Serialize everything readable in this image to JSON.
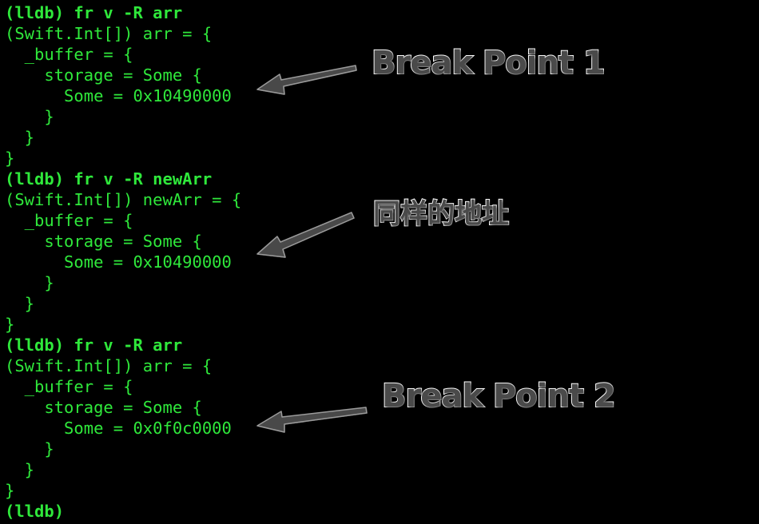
{
  "terminal": {
    "text_color": "#2fe83b",
    "background_color": "#000000",
    "lines": [
      {
        "text": "(lldb) fr v -R arr",
        "kind": "cmd"
      },
      {
        "text": "(Swift.Int[]) arr = {",
        "kind": "out"
      },
      {
        "text": "  _buffer = {",
        "kind": "out"
      },
      {
        "text": "    storage = Some {",
        "kind": "out"
      },
      {
        "text": "      Some = 0x10490000",
        "kind": "out"
      },
      {
        "text": "    }",
        "kind": "out"
      },
      {
        "text": "  }",
        "kind": "out"
      },
      {
        "text": "}",
        "kind": "out"
      },
      {
        "text": "(lldb) fr v -R newArr",
        "kind": "cmd"
      },
      {
        "text": "(Swift.Int[]) newArr = {",
        "kind": "out"
      },
      {
        "text": "  _buffer = {",
        "kind": "out"
      },
      {
        "text": "    storage = Some {",
        "kind": "out"
      },
      {
        "text": "      Some = 0x10490000",
        "kind": "out"
      },
      {
        "text": "    }",
        "kind": "out"
      },
      {
        "text": "  }",
        "kind": "out"
      },
      {
        "text": "}",
        "kind": "out"
      },
      {
        "text": "(lldb) fr v -R arr",
        "kind": "cmd"
      },
      {
        "text": "(Swift.Int[]) arr = {",
        "kind": "out"
      },
      {
        "text": "  _buffer = {",
        "kind": "out"
      },
      {
        "text": "    storage = Some {",
        "kind": "out"
      },
      {
        "text": "      Some = 0x0f0c0000",
        "kind": "out"
      },
      {
        "text": "    }",
        "kind": "out"
      },
      {
        "text": "  }",
        "kind": "out"
      },
      {
        "text": "}",
        "kind": "out"
      },
      {
        "text": "(lldb)",
        "kind": "cmd"
      }
    ]
  },
  "annotations": {
    "break_point_1": "Break Point 1",
    "same_address": "同样的地址",
    "break_point_2": "Break Point 2",
    "text_color": "#4a4a4a",
    "outline_color": "#ffffff",
    "arrow_color": "#4a4a4a"
  }
}
